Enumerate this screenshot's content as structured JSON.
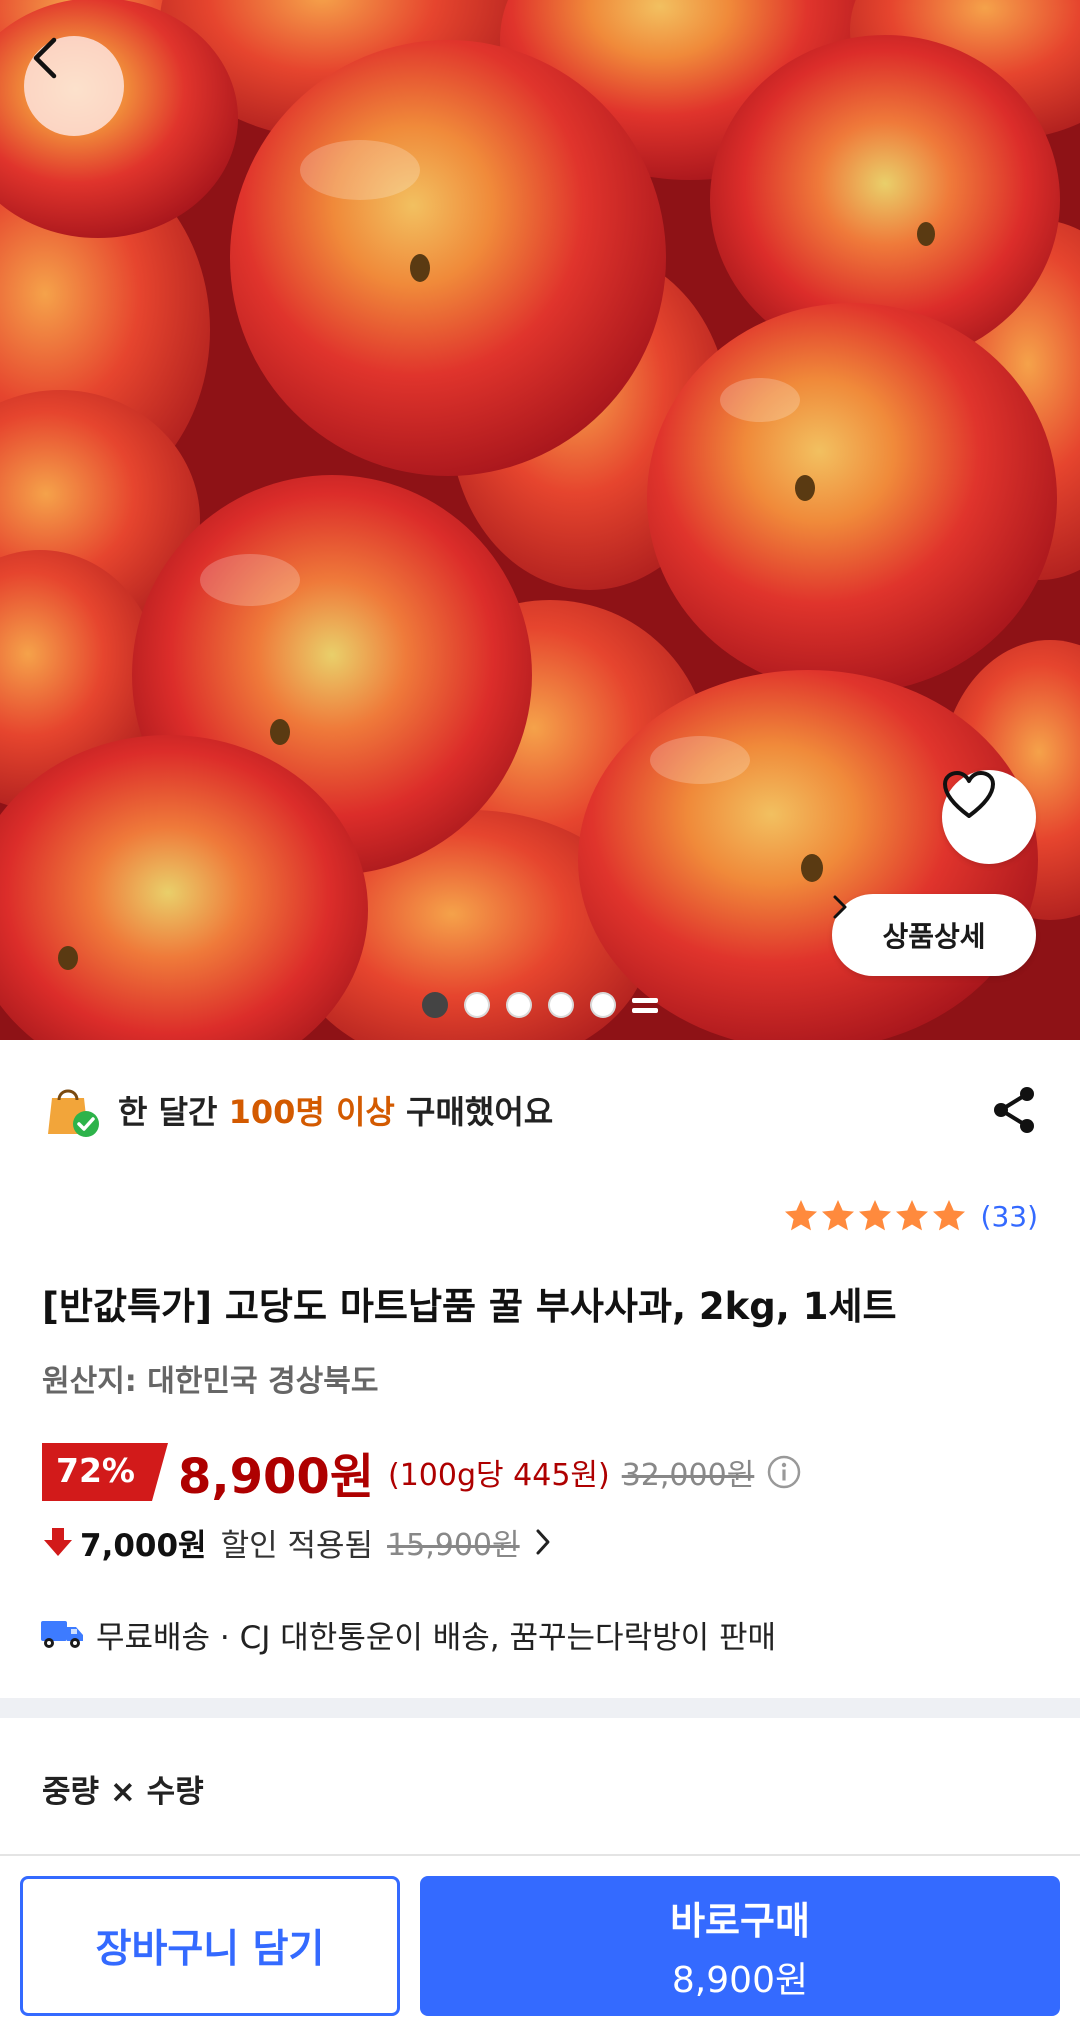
{
  "hero": {
    "image_alt": "",
    "detail_label": "상품상세",
    "carousel_current": 1,
    "carousel_total": 6
  },
  "social_proof": {
    "prefix": "한 달간 ",
    "highlight": "100명 이상",
    "suffix": " 구매했어요"
  },
  "rating": {
    "stars": 5,
    "count": "(33)"
  },
  "product": {
    "title": "[반값특가] 고당도 마트납품 꿀 부사사과, 2kg, 1세트",
    "origin": "원산지: 대한민국 경상북도"
  },
  "price": {
    "discount": "72%",
    "sale": "8,900원",
    "unit": "(100g당 445원)",
    "original": "32,000원"
  },
  "coupon": {
    "amount": "7,000원",
    "label": "할인 적용됨",
    "original": "15,900원"
  },
  "shipping": {
    "text": "무료배송 · CJ 대한통운이 배송, 꿈꾸는다락방이 판매"
  },
  "options": {
    "label": "중량 × 수량"
  },
  "actions": {
    "cart_label": "장바구니 담기",
    "buy_label": "바로구매",
    "buy_price": "8,900원"
  },
  "colors": {
    "accent_blue": "#346aff",
    "price_red": "#ae0000",
    "highlight_orange": "#d35a00",
    "star_orange": "#ff8a3d"
  }
}
